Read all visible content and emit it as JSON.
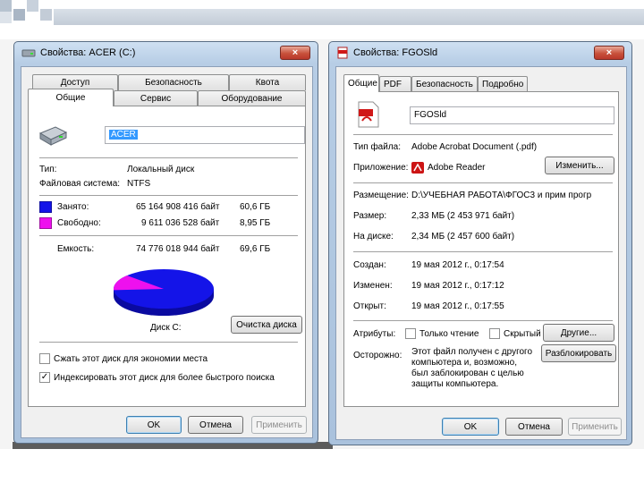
{
  "colors": {
    "used": "#1414e8",
    "free": "#ee10ee",
    "accent": "#3399ff"
  },
  "disk_window": {
    "title": "Свойства: ACER (C:)",
    "close_label": "×",
    "tabs_row1": [
      "Доступ",
      "Безопасность",
      "Квота"
    ],
    "tabs_row2": [
      "Общие",
      "Сервис",
      "Оборудование"
    ],
    "name_value": "ACER",
    "type_label": "Тип:",
    "type_value": "Локальный диск",
    "fs_label": "Файловая система:",
    "fs_value": "NTFS",
    "used_label": "Занято:",
    "used_bytes": "65 164 908 416 байт",
    "used_gb": "60,6 ГБ",
    "free_label": "Свободно:",
    "free_bytes": "9 611 036 528 байт",
    "free_gb": "8,95 ГБ",
    "capacity_label": "Емкость:",
    "capacity_bytes": "74 776 018 944 байт",
    "capacity_gb": "69,6 ГБ",
    "used_fraction": 0.871,
    "drive_caption": "Диск C:",
    "cleanup_button": "Очистка диска",
    "compress_label": "Сжать этот диск для экономии места",
    "compress_checked": false,
    "index_label": "Индексировать этот диск для более быстрого поиска",
    "index_checked": true,
    "ok": "OK",
    "cancel": "Отмена",
    "apply": "Применить",
    "icon": "hard-drive-icon"
  },
  "file_window": {
    "title": "Свойства: FGOSld",
    "close_label": "×",
    "tabs": [
      "Общие",
      "PDF",
      "Безопасность",
      "Подробно"
    ],
    "file_name": "FGOSld",
    "filetype_label": "Тип файла:",
    "filetype_value": "Adobe Acrobat Document (.pdf)",
    "app_label": "Приложение:",
    "app_value": "Adobe Reader",
    "change_button": "Изменить...",
    "location_label": "Размещение:",
    "location_value": "D:\\УЧЕБНАЯ РАБОТА\\ФГОС3 и прим прогр",
    "size_label": "Размер:",
    "size_value": "2,33 МБ (2 453 971 байт)",
    "disk_label": "На диске:",
    "disk_value": "2,34 МБ (2 457 600 байт)",
    "created_label": "Создан:",
    "created_value": "19 мая 2012 г., 0:17:54",
    "modified_label": "Изменен:",
    "modified_value": "19 мая 2012 г., 0:17:12",
    "opened_label": "Открыт:",
    "opened_value": "19 мая 2012 г., 0:17:55",
    "attr_label": "Атрибуты:",
    "readonly_label": "Только чтение",
    "hidden_label": "Скрытый",
    "other_button": "Другие...",
    "caution_label": "Осторожно:",
    "caution_text": [
      "Этот файл получен с другого",
      "компьютера и, возможно,",
      "был заблокирован с целью",
      "защиты компьютера."
    ],
    "unblock_button": "Разблокировать",
    "ok": "OK",
    "cancel": "Отмена",
    "apply": "Применить",
    "icon": "pdf-file-icon"
  }
}
